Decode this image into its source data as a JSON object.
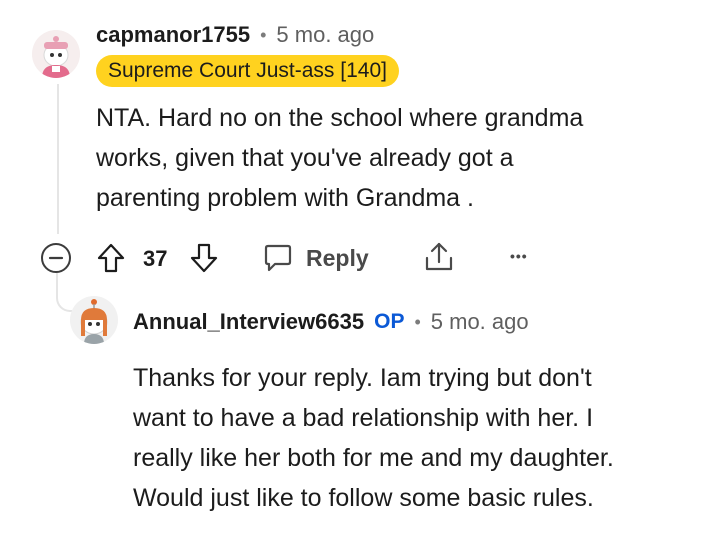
{
  "comment": {
    "username": "capmanor1755",
    "separator": "•",
    "time": "5 mo. ago",
    "flair": "Supreme Court Just-ass [140]",
    "body_lines": [
      "NTA. Hard no on the school where grandma",
      "works, given that you've already got a",
      "parenting problem with Grandma ."
    ],
    "vote_count": "37",
    "reply_label": "Reply",
    "more_label": "•••"
  },
  "reply": {
    "username": "Annual_Interview6635",
    "op_badge": "OP",
    "separator": "•",
    "time": "5 mo. ago",
    "body_lines": [
      "Thanks for your reply. Iam trying but don't",
      "want to have a bad relationship with her. I",
      "really like her both for me and my daughter.",
      "Would just like to follow some basic rules."
    ]
  },
  "colors": {
    "flair_bg": "#ffd21f",
    "op_blue": "#0b59d6",
    "thread_line": "#e5e5e5"
  },
  "icons": [
    "collapse-icon",
    "upvote-icon",
    "downvote-icon",
    "reply-icon",
    "share-icon",
    "more-icon"
  ]
}
